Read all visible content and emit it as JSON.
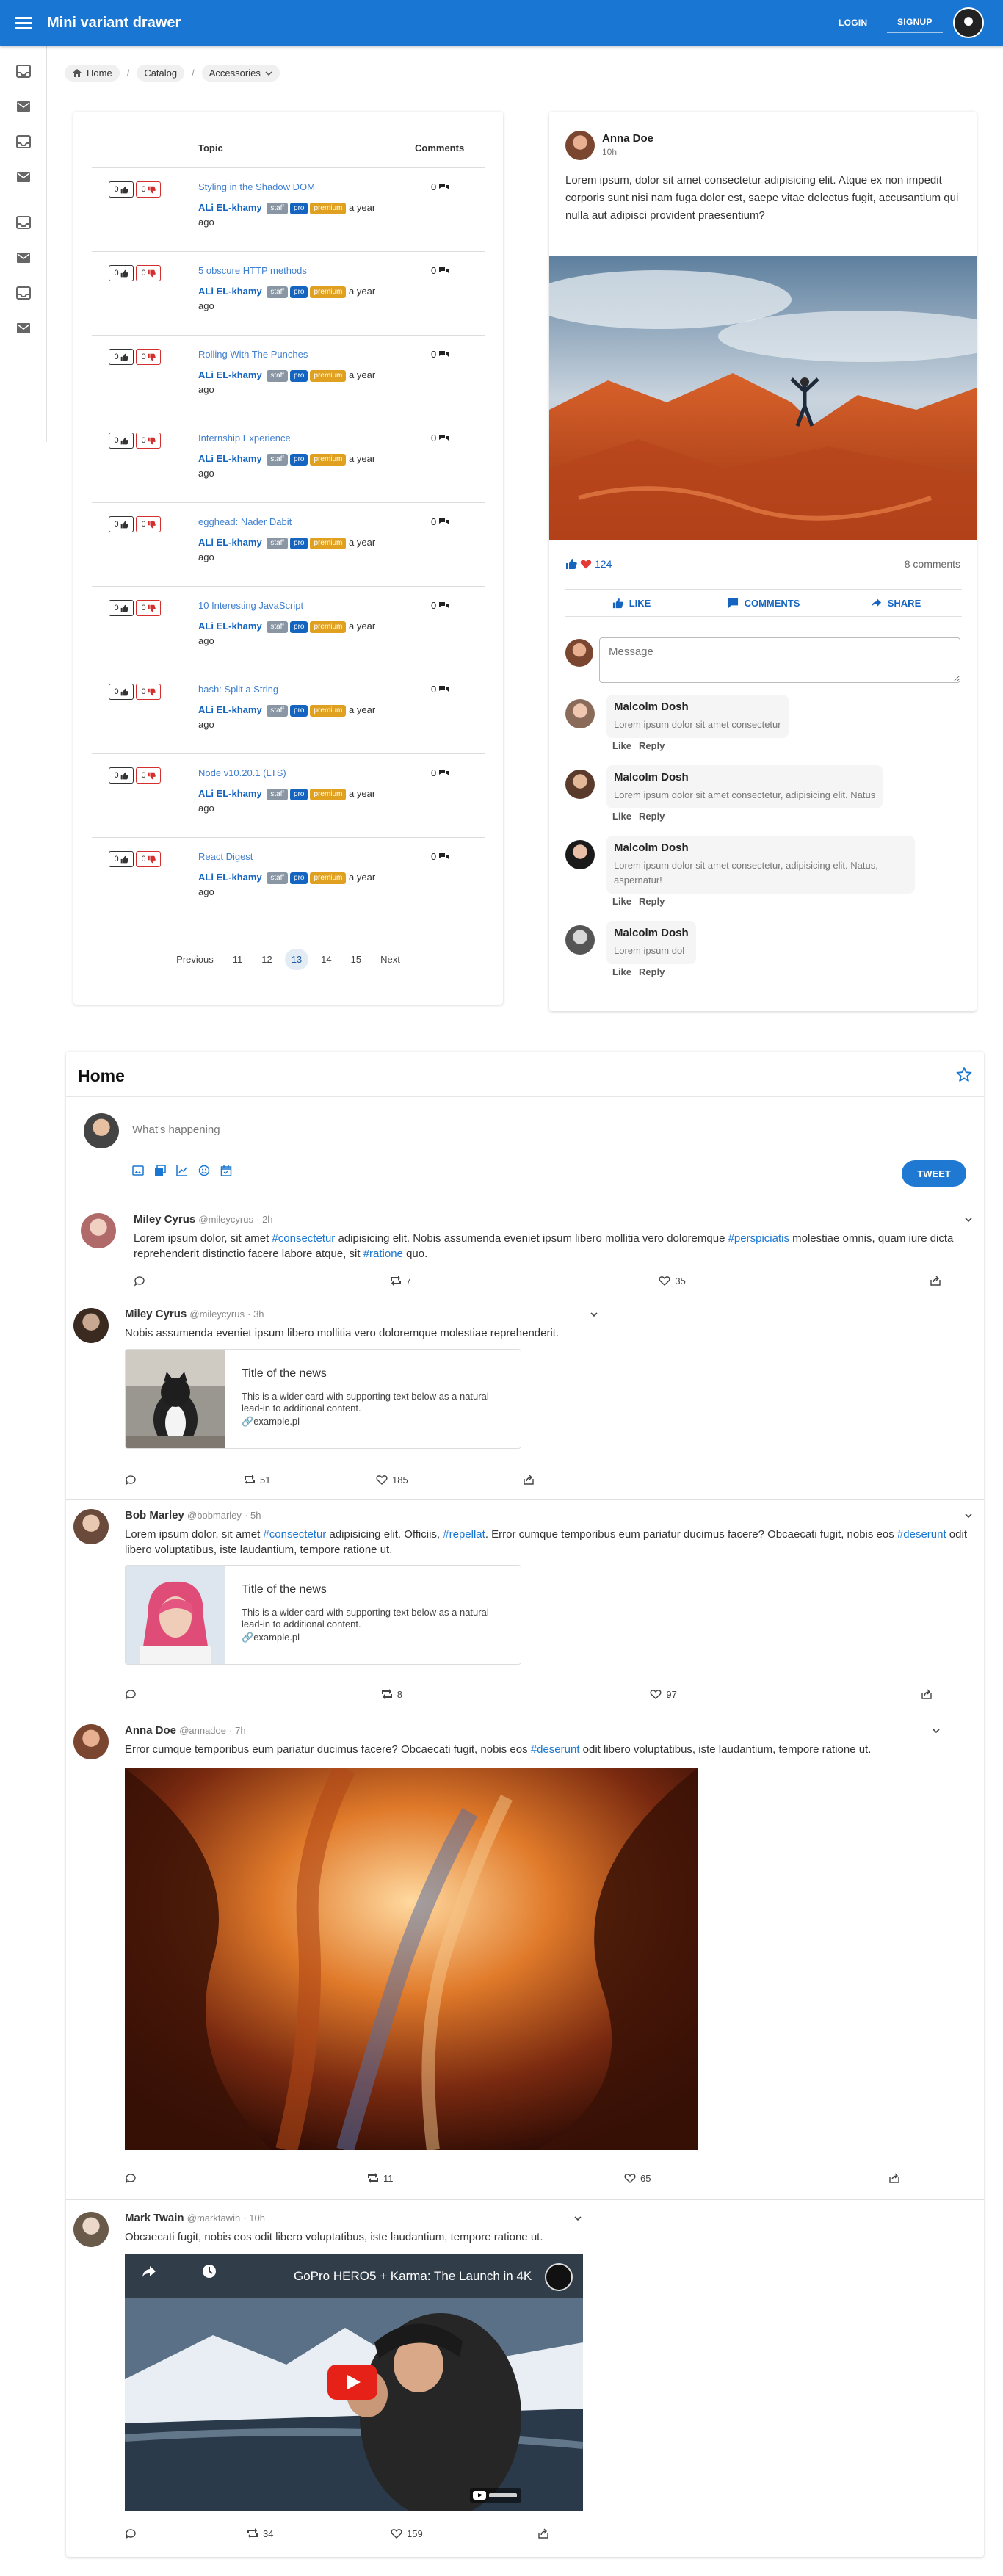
{
  "appbar": {
    "title": "Mini variant drawer",
    "login": "LOGIN",
    "signup": "SIGNUP"
  },
  "drawer": {
    "icons": [
      "inbox-icon",
      "mail-icon",
      "inbox-icon",
      "mail-icon",
      "inbox-icon",
      "mail-icon",
      "inbox-icon",
      "mail-icon"
    ]
  },
  "breadcrumb": {
    "home": "Home",
    "catalog": "Catalog",
    "accessories": "Accessories"
  },
  "forum": {
    "col_topic": "Topic",
    "col_comments": "Comments",
    "rows": [
      {
        "up": "0",
        "down": "0",
        "topic": "Styling in the Shadow DOM",
        "author": "ALi EL-khamy",
        "staff": "staff",
        "pro": "pro",
        "premium": "premium",
        "time": "a year ago",
        "comments": "0"
      },
      {
        "up": "0",
        "down": "0",
        "topic": "5 obscure HTTP methods",
        "author": "ALi EL-khamy",
        "staff": "staff",
        "pro": "pro",
        "premium": "premium",
        "time": "a year ago",
        "comments": "0"
      },
      {
        "up": "0",
        "down": "0",
        "topic": "Rolling With The Punches",
        "author": "ALi EL-khamy",
        "staff": "staff",
        "pro": "pro",
        "premium": "premium",
        "time": "a year ago",
        "comments": "0"
      },
      {
        "up": "0",
        "down": "0",
        "topic": "Internship Experience",
        "author": "ALi EL-khamy",
        "staff": "staff",
        "pro": "pro",
        "premium": "premium",
        "time": "a year ago",
        "comments": "0"
      },
      {
        "up": "0",
        "down": "0",
        "topic": "egghead: Nader Dabit",
        "author": "ALi EL-khamy",
        "staff": "staff",
        "pro": "pro",
        "premium": "premium",
        "time": "a year ago",
        "comments": "0"
      },
      {
        "up": "0",
        "down": "0",
        "topic": "10 Interesting JavaScript",
        "author": "ALi EL-khamy",
        "staff": "staff",
        "pro": "pro",
        "premium": "premium",
        "time": "a year ago",
        "comments": "0"
      },
      {
        "up": "0",
        "down": "0",
        "topic": "bash: Split a String",
        "author": "ALi EL-khamy",
        "staff": "staff",
        "pro": "pro",
        "premium": "premium",
        "time": "a year ago",
        "comments": "0"
      },
      {
        "up": "0",
        "down": "0",
        "topic": "Node v10.20.1 (LTS)",
        "author": "ALi EL-khamy",
        "staff": "staff",
        "pro": "pro",
        "premium": "premium",
        "time": "a year ago",
        "comments": "0"
      },
      {
        "up": "0",
        "down": "0",
        "topic": "React Digest",
        "author": "ALi EL-khamy",
        "staff": "staff",
        "pro": "pro",
        "premium": "premium",
        "time": "a year ago",
        "comments": "0"
      }
    ],
    "pager": {
      "prev": "Previous",
      "pages": [
        "11",
        "12",
        "13",
        "14",
        "15"
      ],
      "active": "13",
      "next": "Next"
    }
  },
  "post": {
    "author": "Anna Doe",
    "time": "10h",
    "text": "Lorem ipsum, dolor sit amet consectetur adipisicing elit. Atque ex non impedit corporis sunt nisi nam fuga dolor est, saepe vitae delectus fugit, accusantium qui nulla aut adipisci provident praesentium?",
    "reactions": "124",
    "comments_count": "8 comments",
    "like": "LIKE",
    "comments": "COMMENTS",
    "share": "SHARE",
    "message_placeholder": "Message",
    "comment_list": [
      {
        "name": "Malcolm Dosh",
        "text": "Lorem ipsum dolor sit amet consectetur",
        "like": "Like",
        "reply": "Reply"
      },
      {
        "name": "Malcolm Dosh",
        "text": "Lorem ipsum dolor sit amet consectetur, adipisicing elit. Natus",
        "like": "Like",
        "reply": "Reply"
      },
      {
        "name": "Malcolm Dosh",
        "text": "Lorem ipsum dolor sit amet consectetur, adipisicing elit. Natus, aspernatur!",
        "like": "Like",
        "reply": "Reply"
      },
      {
        "name": "Malcolm Dosh",
        "text": "Lorem ipsum dol",
        "like": "Like",
        "reply": "Reply"
      }
    ]
  },
  "feed": {
    "title": "Home",
    "compose_placeholder": "What's happening",
    "tweet_button": "TWEET",
    "tweets": [
      {
        "name": "Miley Cyrus",
        "handle": "@mileycyrus",
        "time": "· 2h",
        "t1": "Lorem ipsum dolor, sit amet ",
        "h1": "#consectetur",
        "t2": " adipisicing elit. Nobis assumenda eveniet ipsum libero mollitia vero doloremque ",
        "h2": "#perspiciatis",
        "t3": " molestiae omnis, quam iure dicta reprehenderit distinctio facere labore atque, sit ",
        "h3": "#ratione",
        "t4": " quo.",
        "retweets": "7",
        "likes": "35"
      },
      {
        "name": "Miley Cyrus",
        "handle": "@mileycyrus",
        "time": "· 3h",
        "text": "Nobis assumenda eveniet ipsum libero mollitia vero doloremque molestiae reprehenderit.",
        "card_title": "Title of the news",
        "card_desc": "This is a wider card with supporting text below as a natural lead-in to additional content.",
        "card_link": "example.pl",
        "retweets": "51",
        "likes": "185"
      },
      {
        "name": "Bob Marley",
        "handle": "@bobmarley",
        "time": "· 5h",
        "t1": "Lorem ipsum dolor, sit amet ",
        "h1": "#consectetur",
        "t2": " adipisicing elit. Officiis, ",
        "h2": "#repellat",
        "t3": ". Error cumque temporibus eum pariatur ducimus facere? Obcaecati fugit, nobis eos ",
        "h3": "#deserunt",
        "t4": " odit libero voluptatibus, iste laudantium, tempore ratione ut.",
        "card_title": "Title of the news",
        "card_desc": "This is a wider card with supporting text below as a natural lead-in to additional content.",
        "card_link": "example.pl",
        "retweets": "8",
        "likes": "97"
      },
      {
        "name": "Anna Doe",
        "handle": "@annadoe",
        "time": "· 7h",
        "t1": "Error cumque temporibus eum pariatur ducimus facere? Obcaecati fugit, nobis eos ",
        "h1": "#deserunt",
        "t2": " odit libero voluptatibus, iste laudantium, tempore ratione ut.",
        "retweets": "11",
        "likes": "65"
      },
      {
        "name": "Mark Twain",
        "handle": "@marktawin",
        "time": "· 10h",
        "text": "Obcaecati fugit, nobis eos odit libero voluptatibus, iste laudantium, tempore ratione ut.",
        "video_title": "GoPro HERO5 + Karma: The Launch in 4K",
        "retweets": "34",
        "likes": "159"
      }
    ]
  },
  "colors": {
    "primary": "#1976d2",
    "link": "#3f7fd0",
    "badge_staff": "#8a96a3",
    "badge_pro": "#1565c0",
    "badge_premium": "#e0a020",
    "downvote": "#d32f2f"
  }
}
